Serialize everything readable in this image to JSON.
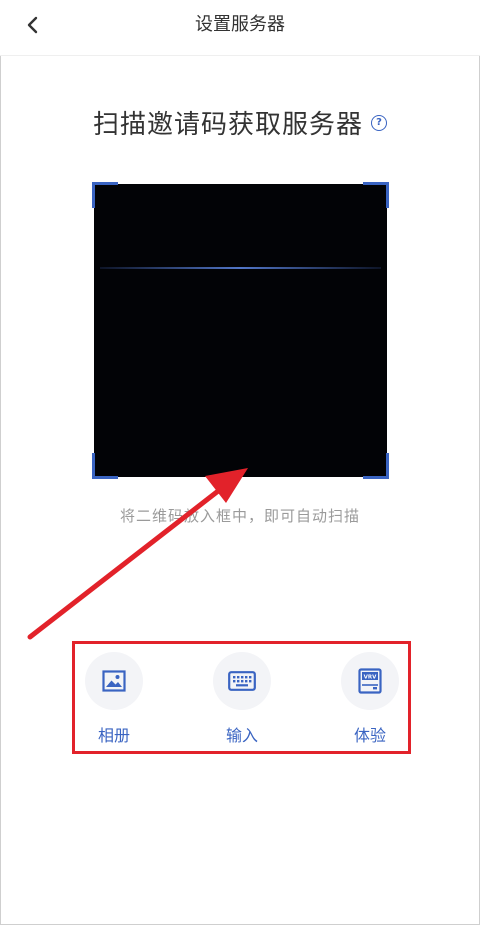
{
  "header": {
    "title": "设置服务器"
  },
  "main": {
    "headline": "扫描邀请码获取服务器",
    "help_icon_glyph": "?",
    "hint": "将二维码放入框中，即可自动扫描"
  },
  "actions": [
    {
      "label": "相册",
      "icon": "image-icon"
    },
    {
      "label": "输入",
      "icon": "keyboard-icon"
    },
    {
      "label": "体验",
      "icon": "vrv-device-icon"
    }
  ],
  "vrv_icon_text": "VRV",
  "colors": {
    "accent": "#3a64c2",
    "annotation_red": "#e2222a",
    "scanner_bg": "#020306",
    "hint_text": "#9a9a9a"
  }
}
